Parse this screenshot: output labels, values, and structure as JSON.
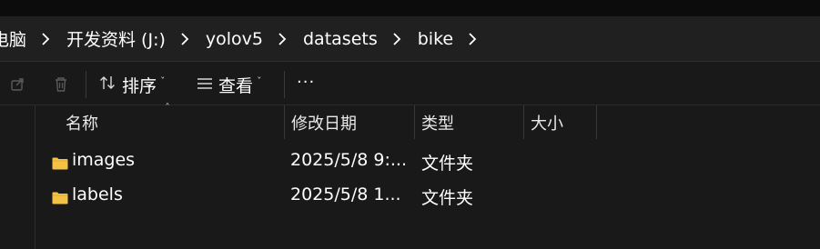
{
  "breadcrumb": {
    "items": [
      "电脑",
      "开发资料 (J:)",
      "yolov5",
      "datasets",
      "bike"
    ]
  },
  "toolbar": {
    "sort_label": "排序",
    "view_label": "查看",
    "more_label": "···"
  },
  "columns": {
    "name": "名称",
    "modified": "修改日期",
    "type": "类型",
    "size": "大小"
  },
  "files": [
    {
      "name": "images",
      "modified": "2025/5/8 9:...",
      "type": "文件夹",
      "icon": "folder-icon"
    },
    {
      "name": "labels",
      "modified": "2025/5/8 1...",
      "type": "文件夹",
      "icon": "folder-icon"
    }
  ],
  "colors": {
    "folder": "#f3c245",
    "background": "#191919",
    "addressbar": "#202020"
  }
}
